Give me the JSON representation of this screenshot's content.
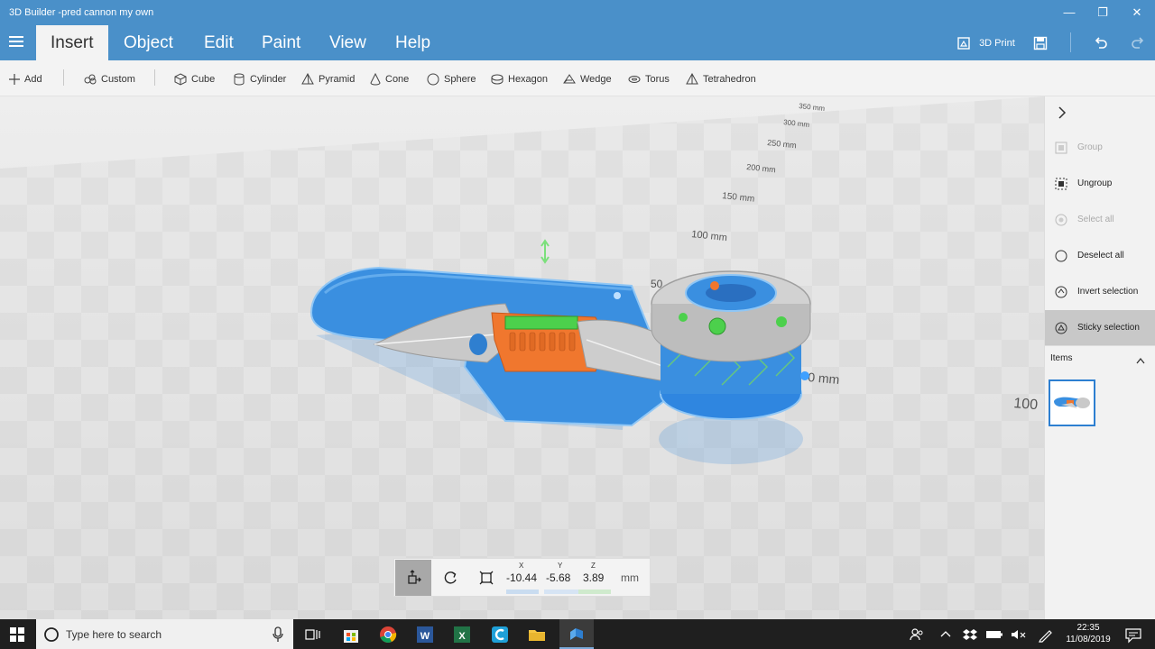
{
  "window": {
    "title": "3D Builder -pred cannon my own"
  },
  "ribbon": {
    "tabs": [
      "Insert",
      "Object",
      "Edit",
      "Paint",
      "View",
      "Help"
    ],
    "print_label": "3D Print"
  },
  "toolbar": {
    "add": "Add",
    "custom": "Custom",
    "shapes": [
      "Cube",
      "Cylinder",
      "Pyramid",
      "Cone",
      "Sphere",
      "Hexagon",
      "Wedge",
      "Torus",
      "Tetrahedron"
    ]
  },
  "ruler": [
    "350 mm",
    "300 mm",
    "250 mm",
    "200 mm",
    "150 mm",
    "100 mm",
    "50",
    "0 mm",
    "100"
  ],
  "panel": {
    "group": "Group",
    "ungroup": "Ungroup",
    "select_all": "Select all",
    "deselect_all": "Deselect all",
    "invert_selection": "Invert selection",
    "sticky_selection": "Sticky selection",
    "items_header": "Items"
  },
  "coords": {
    "x_label": "X",
    "y_label": "Y",
    "z_label": "Z",
    "x": "-10.44",
    "y": "-5.68",
    "z": "3.89",
    "unit": "mm"
  },
  "taskbar": {
    "search_placeholder": "Type here to search",
    "time": "22:35",
    "date": "11/08/2019"
  },
  "colors": {
    "accent": "#4a90c9",
    "model_blue": "#3a8fe0",
    "orange": "#f0772e",
    "green": "#4cd04c"
  }
}
